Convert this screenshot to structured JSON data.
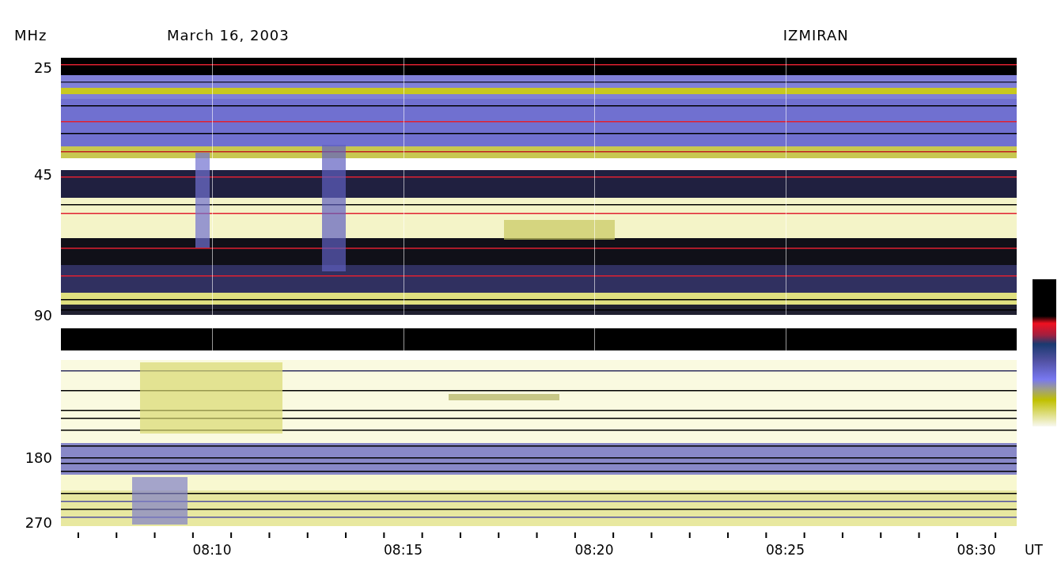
{
  "header": {
    "axis_unit": "MHz",
    "date": "March 16, 2003",
    "observatory": "IZMIRAN"
  },
  "frequency_labels": [
    "25",
    "45",
    "90",
    "180",
    "270"
  ],
  "time_labels": [
    "08:10",
    "08:15",
    "08:20",
    "08:25",
    "08:30"
  ],
  "time_unit": "UT"
}
